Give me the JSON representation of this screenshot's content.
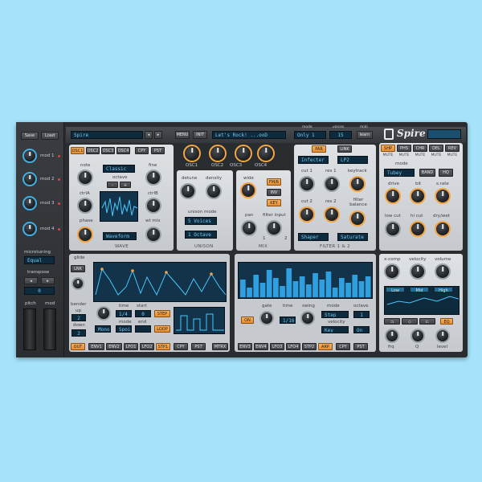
{
  "colors": {
    "background": "#a6e3fa",
    "accent": "#f3a545",
    "lcd_text": "#78c9f2",
    "panel": "#cfd3d7"
  },
  "top": {
    "preset": "Spire",
    "menu": "MENU",
    "init": "INIT",
    "patch_name": "Let's Rock! ...ooD",
    "mode_label": "mode",
    "mode_value": "Only 1",
    "voices_label": "voices",
    "voices_value": "15",
    "midi_label": "midi",
    "midi_value": "learn",
    "logo": "Spire"
  },
  "sidebar": {
    "top_buttons": [
      "Save",
      "Load"
    ],
    "mods": [
      "mod 1",
      "mod 2",
      "mod 3",
      "mod 4"
    ],
    "microtuning": "microtuning",
    "microtuning_value": "Equal",
    "transpose": "transpose",
    "transpose_value": "0",
    "pitch": "pitch",
    "mod": "mod"
  },
  "osc": {
    "tabs": [
      "OSC1",
      "OSC2",
      "OSC3",
      "OSC4"
    ],
    "copy": "CPY",
    "paste": "PST",
    "octave": "octave",
    "note": "note",
    "fine": "fine",
    "ctrlA": "ctrlA",
    "ctrlB": "ctrlB",
    "phase": "phase",
    "wt_mix": "wt mix",
    "wave_type": "Classic",
    "waveform": "Waveform",
    "wave_title": "WAVE",
    "knob_labels": [
      "OSC1",
      "OSC2",
      "OSC3",
      "OSC4"
    ]
  },
  "unison": {
    "detune": "detune",
    "density": "density",
    "unison_mode": "unison mode",
    "mode_value": "5 Voices",
    "octave_value": "1 Octave",
    "title": "UNISON"
  },
  "mix": {
    "wide": "wide",
    "pan": "pan",
    "filter_input": "filter input",
    "fm": "FM/R",
    "inv": "INV",
    "key": "KEY",
    "title": "MIX",
    "ch1": "1",
    "ch2": "2"
  },
  "filter": {
    "par": "PAR",
    "link": "LINK",
    "type1": "Infecter",
    "type2": "LP2",
    "cut1": "cut 1",
    "res1": "res 1",
    "keytrack": "keytrack",
    "cut2": "cut 2",
    "res2": "res 2",
    "filter_balance": "filter balance",
    "shaper": "Shaper",
    "saturate": "Saturate",
    "title": "FILTER 1 & 2"
  },
  "fx": {
    "tabs": [
      "SHP",
      "PHS",
      "CHR",
      "DEL",
      "REV"
    ],
    "mute": "MUTE",
    "mode": "mode",
    "mode_value": "Tubey",
    "band": "BAND",
    "hq": "HQ",
    "drive": "drive",
    "bit": "bit",
    "srate": "s.rate",
    "low_cut": "low cut",
    "hi_cut": "hi cut",
    "dry_wet": "dry/wet",
    "xcomp": "x-comp",
    "velocity": "velocity",
    "volume": "volume",
    "eq_labels": [
      "Low",
      "Mid",
      "High"
    ],
    "eq": "EQ",
    "freq": "frq",
    "q": "Q",
    "level": "level"
  },
  "env": {
    "glide": "glide",
    "link": "LNK",
    "bender": "bender",
    "up": "up",
    "down": "down",
    "up_value": "2",
    "down_value": "2",
    "time": "time",
    "start": "start",
    "mode": "mode",
    "end": "end",
    "time_value": "1/4",
    "start_value": "0",
    "mode_value": "Mono",
    "end_value": "Spoi",
    "step": "STEP",
    "loop": "LOOP",
    "tabs": [
      "OUT",
      "ENV1",
      "ENV2",
      "LFO1",
      "LFO2",
      "STP1"
    ],
    "copy": "CPY",
    "paste": "PST",
    "matrix": "MTRX"
  },
  "arp": {
    "on": "ON",
    "gate": "gate",
    "time": "time",
    "swing": "swing",
    "mode": "mode",
    "octave": "octave",
    "velocity": "velocity",
    "time_value": "1/16",
    "mode_value": "Step",
    "octave_value": "1",
    "vel_value": "Key",
    "vel2_value": "On",
    "tabs": [
      "ENV3",
      "ENV4",
      "LFO3",
      "LFO4",
      "STP2",
      "ARP"
    ],
    "copy": "CPY",
    "paste": "PST"
  },
  "arp_steps": [
    0.55,
    0.3,
    0.7,
    0.45,
    0.85,
    0.6,
    0.35,
    0.9,
    0.5,
    0.65,
    0.4,
    0.75,
    0.55,
    0.8,
    0.3,
    0.6,
    0.45,
    0.7,
    0.5,
    0.65
  ]
}
